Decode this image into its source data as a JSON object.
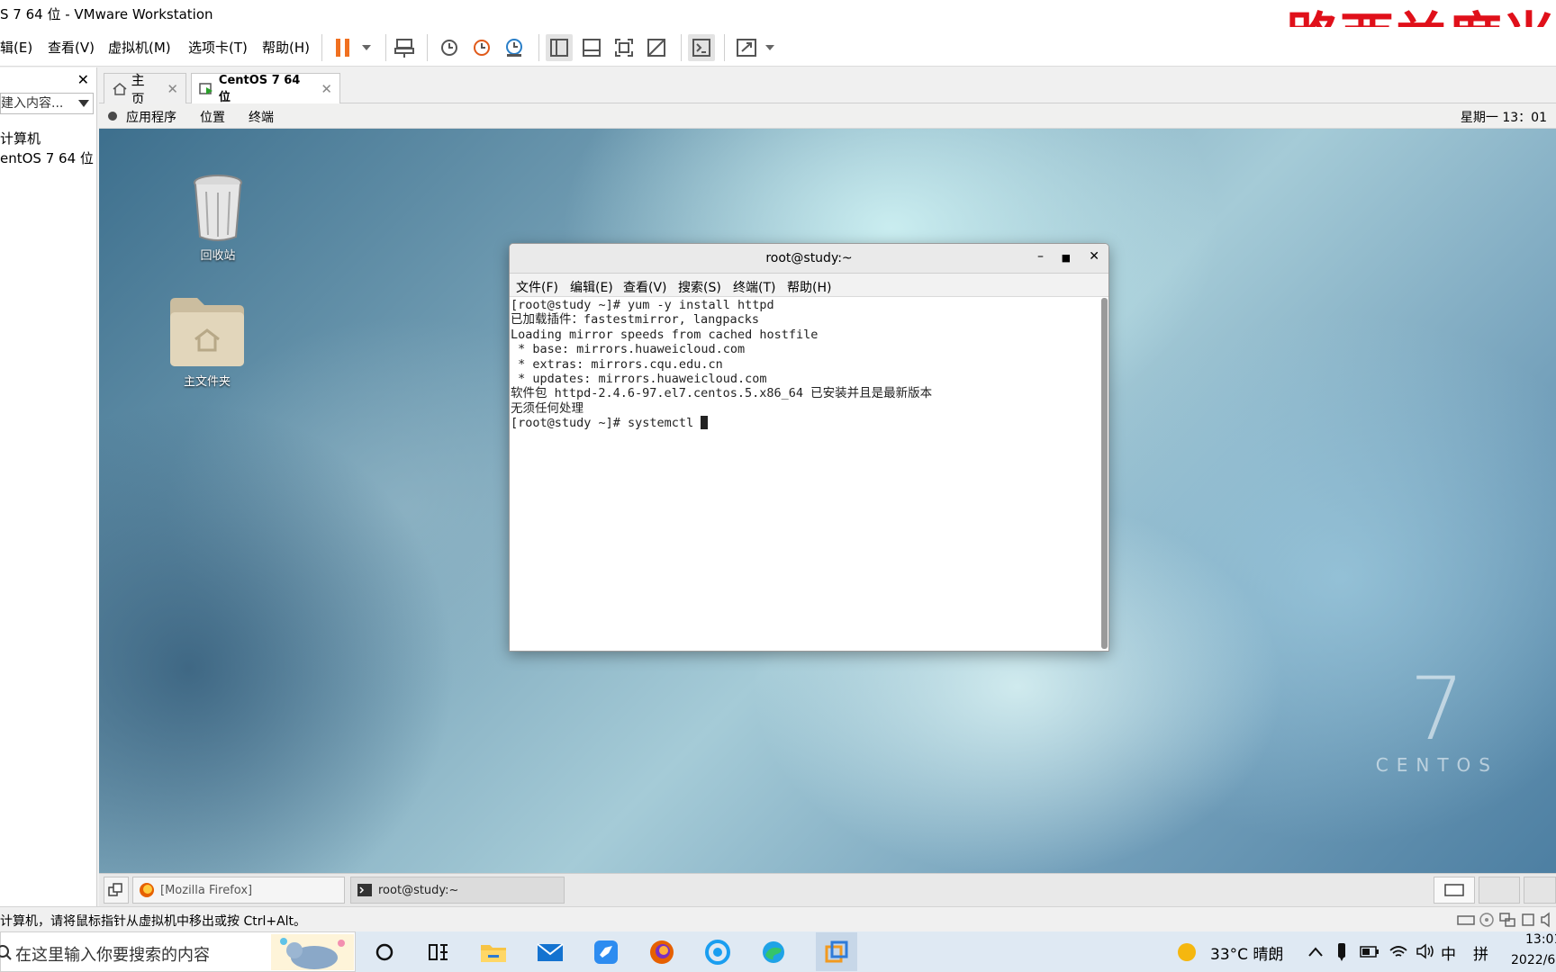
{
  "window": {
    "title": "S 7 64 位 - VMware Workstation",
    "watermark": "路西兰度当"
  },
  "menu": {
    "items": [
      "辑(E)",
      "查看(V)",
      "虚拟机(M)",
      "选项卡(T)",
      "帮助(H)"
    ]
  },
  "library": {
    "search_placeholder": "建入内容...",
    "tree": [
      "计算机",
      "entOS 7 64 位"
    ]
  },
  "tabs": [
    {
      "label": "主页"
    },
    {
      "label": "CentOS 7 64 位"
    }
  ],
  "gnome": {
    "applications": "应用程序",
    "places": "位置",
    "terminal": "终端",
    "clock": "星期一 13：01"
  },
  "desktop": {
    "icons": [
      {
        "label": "回收站",
        "icon": "trash-icon"
      },
      {
        "label": "主文件夹",
        "icon": "home-folder-icon"
      }
    ],
    "logo_number": "7",
    "logo_word": "CENTOS"
  },
  "terminal": {
    "title": "root@study:~",
    "menu": [
      "文件(F)",
      "编辑(E)",
      "查看(V)",
      "搜索(S)",
      "终端(T)",
      "帮助(H)"
    ],
    "lines": [
      "[root@study ~]# yum -y install httpd",
      "已加载插件：fastestmirror, langpacks",
      "Loading mirror speeds from cached hostfile",
      " * base: mirrors.huaweicloud.com",
      " * extras: mirrors.cqu.edu.cn",
      " * updates: mirrors.huaweicloud.com",
      "软件包 httpd-2.4.6-97.el7.centos.5.x86_64 已安装并且是最新版本",
      "无须任何处理"
    ],
    "prompt": "[root@study ~]# systemctl "
  },
  "guest_taskbar": {
    "windows": [
      "[Mozilla Firefox]",
      "root@study:~"
    ]
  },
  "status": {
    "message": "计算机，请将鼠标指针从虚拟机中移出或按 Ctrl+Alt。"
  },
  "taskbar": {
    "search_text": "在这里输入你要搜索的内容",
    "weather": "33°C 晴朗",
    "ime1": "中",
    "ime2": "拼",
    "time": "13:01",
    "date": "2022/6"
  }
}
